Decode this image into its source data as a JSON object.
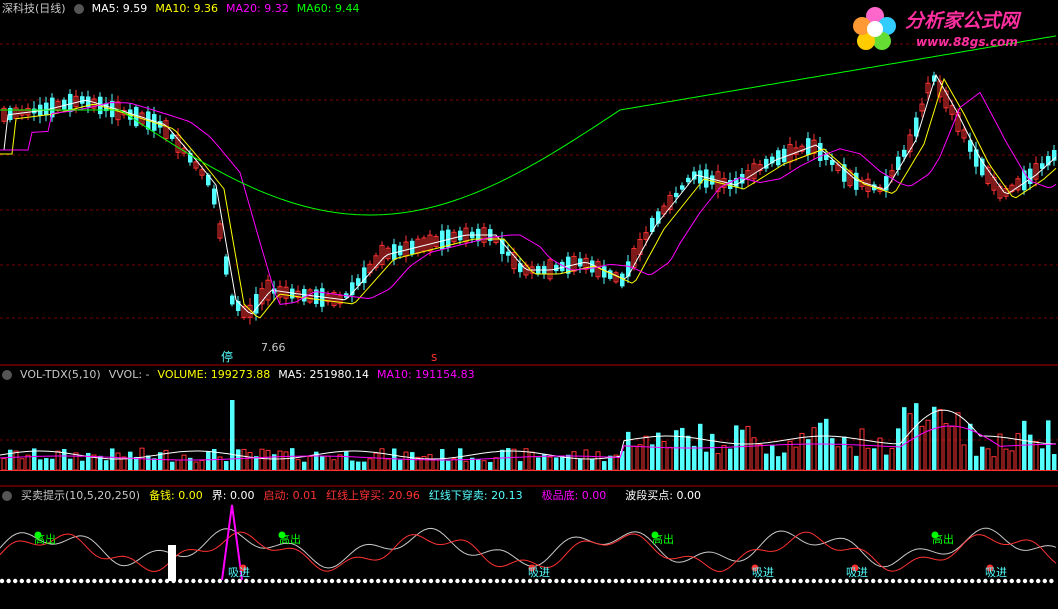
{
  "colors": {
    "up": "#ff3232",
    "down": "#54ffff",
    "ma5": "#ffffff",
    "ma10": "#ffff00",
    "ma20": "#ff00ff",
    "ma60": "#00ff00",
    "grid": "#7a0000",
    "sep": "#b00000",
    "yellow": "#ffff00",
    "white": "#c8c8c8",
    "magenta": "#ff00ff",
    "red": "#ff3232",
    "cyan": "#54ffff",
    "green": "#00ff00"
  },
  "main_header": {
    "title": "深科技(日线)",
    "ma5_label": "MA5: 9.59",
    "ma10_label": "MA10: 9.36",
    "ma20_label": "MA20: 9.32",
    "ma60_label": "MA60: 9.44"
  },
  "logo": {
    "name": "分析家公式网",
    "url": "www.88gs.com"
  },
  "annotations": {
    "low_value": "7.66",
    "stop_marker": "停",
    "s_marker": "s"
  },
  "vol_header": {
    "indicator": "VOL-TDX(5,10)",
    "vvol": "VVOL: -",
    "volume": "VOLUME: 199273.88",
    "ma5": "MA5: 251980.14",
    "ma10": "MA10: 191154.83"
  },
  "sig_header": {
    "indicator": "买卖提示(10,5,20,250)",
    "bx": "备钱: 0.00",
    "jie": "界: 0.00",
    "qidong": "启动: 0.01",
    "red_cross": "红线上穿买: 20.96",
    "cyan_cross": "红线下穿卖: 20.13",
    "jipin": "极品底: 0.00",
    "boduan": "波段买点: 0.00"
  },
  "signals": {
    "sell_label": "高出",
    "buy_label": "吸进"
  },
  "chart_data": [
    {
      "type": "candlestick",
      "title": "深科技(日线)",
      "series": [
        {
          "name": "MA5",
          "value": 9.59
        },
        {
          "name": "MA10",
          "value": 9.36
        },
        {
          "name": "MA20",
          "value": 9.32
        },
        {
          "name": "MA60",
          "value": 9.44
        }
      ],
      "annotation_low": 7.66
    },
    {
      "type": "bar",
      "title": "VOL-TDX(5,10)",
      "series": [
        {
          "name": "VOLUME",
          "value": 199273.88
        },
        {
          "name": "MA5",
          "value": 251980.14
        },
        {
          "name": "MA10",
          "value": 191154.83
        }
      ]
    },
    {
      "type": "line",
      "title": "买卖提示(10,5,20,250)",
      "series": [
        {
          "name": "备钱",
          "value": 0.0
        },
        {
          "name": "界",
          "value": 0.0
        },
        {
          "name": "启动",
          "value": 0.01
        },
        {
          "name": "红线上穿买",
          "value": 20.96
        },
        {
          "name": "红线下穿卖",
          "value": 20.13
        },
        {
          "name": "极品底",
          "value": 0.0
        },
        {
          "name": "波段买点",
          "value": 0.0
        }
      ]
    }
  ]
}
